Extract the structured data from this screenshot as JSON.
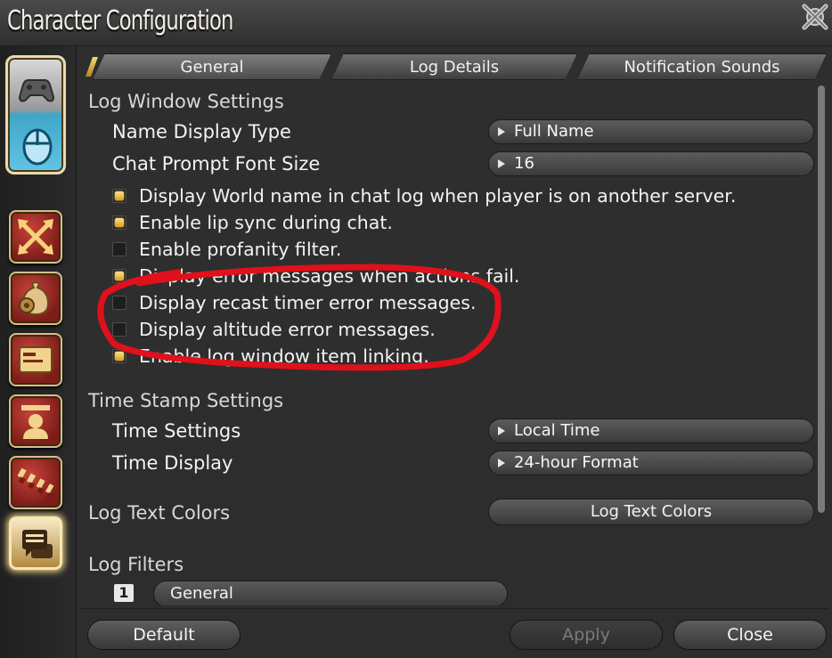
{
  "window": {
    "title": "Character Configuration"
  },
  "tabs": [
    {
      "label": "General"
    },
    {
      "label": "Log Details"
    },
    {
      "label": "Notification Sounds"
    }
  ],
  "log_window_settings": {
    "title": "Log Window Settings",
    "name_display_type": {
      "label": "Name Display Type",
      "value": "Full Name"
    },
    "chat_prompt_font_size": {
      "label": "Chat Prompt Font Size",
      "value": "16"
    },
    "checkboxes": [
      {
        "label": "Display World name in chat log when player is on another server.",
        "checked": true
      },
      {
        "label": "Enable lip sync during chat.",
        "checked": true
      },
      {
        "label": "Enable profanity filter.",
        "checked": false
      },
      {
        "label": "Display error messages when actions fail.",
        "checked": true
      },
      {
        "label": "Display recast timer error messages.",
        "checked": false
      },
      {
        "label": "Display altitude error messages.",
        "checked": false
      },
      {
        "label": "Enable log window item linking.",
        "checked": true
      }
    ]
  },
  "time_stamp_settings": {
    "title": "Time Stamp Settings",
    "time_settings": {
      "label": "Time Settings",
      "value": "Local Time"
    },
    "time_display": {
      "label": "Time Display",
      "value": "24-hour Format"
    }
  },
  "log_text_colors": {
    "label": "Log Text Colors",
    "button": "Log Text Colors"
  },
  "log_filters": {
    "title": "Log Filters",
    "number": "1",
    "name": "General"
  },
  "footer": {
    "default": "Default",
    "apply": "Apply",
    "close": "Close"
  },
  "colors": {
    "accent_gold": "#d9a020",
    "annotation_red": "#e0101c"
  }
}
